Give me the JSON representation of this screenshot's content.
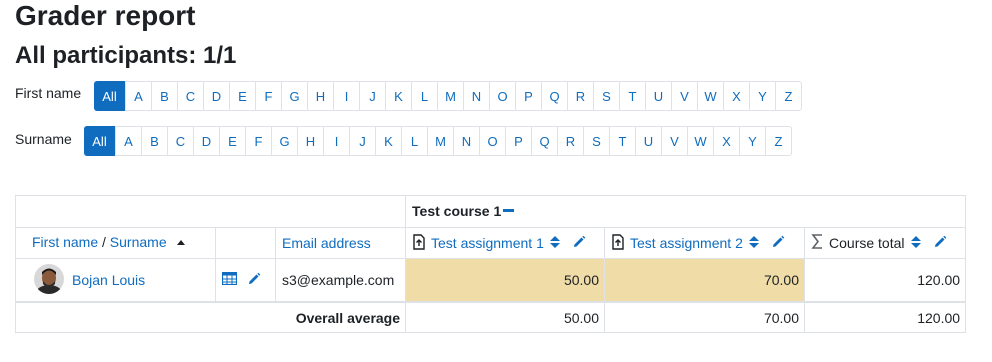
{
  "page": {
    "title": "Grader report",
    "participants": "All participants: 1/1"
  },
  "firstname_filter": {
    "label": "First name",
    "letters": [
      "All",
      "A",
      "B",
      "C",
      "D",
      "E",
      "F",
      "G",
      "H",
      "I",
      "J",
      "K",
      "L",
      "M",
      "N",
      "O",
      "P",
      "Q",
      "R",
      "S",
      "T",
      "U",
      "V",
      "W",
      "X",
      "Y",
      "Z"
    ],
    "active": "All"
  },
  "surname_filter": {
    "label": "Surname",
    "letters": [
      "All",
      "A",
      "B",
      "C",
      "D",
      "E",
      "F",
      "G",
      "H",
      "I",
      "J",
      "K",
      "L",
      "M",
      "N",
      "O",
      "P",
      "Q",
      "R",
      "S",
      "T",
      "U",
      "V",
      "W",
      "X",
      "Y",
      "Z"
    ],
    "active": "All"
  },
  "table": {
    "category": "Test course 1",
    "headers": {
      "firstname": "First name",
      "separator": " / ",
      "surname": "Surname",
      "email": "Email address",
      "items": [
        "Test assignment 1",
        "Test assignment 2"
      ],
      "total": "Course total"
    },
    "user": {
      "name": "Bojan Louis",
      "email": "s3@example.com",
      "grades": [
        "50.00",
        "70.00"
      ],
      "total": "120.00"
    },
    "average": {
      "label": "Overall average",
      "grades": [
        "50.00",
        "70.00"
      ],
      "total": "120.00"
    }
  },
  "colors": {
    "link": "#0f6cbf",
    "graded_cell": "#f0dca6",
    "active_letter": "#0f6cbf"
  },
  "icons": [
    "sort-asc-icon",
    "assignment-icon",
    "sort-icon",
    "edit-icon",
    "sigma-icon",
    "grid-icon",
    "collapse-icon"
  ]
}
